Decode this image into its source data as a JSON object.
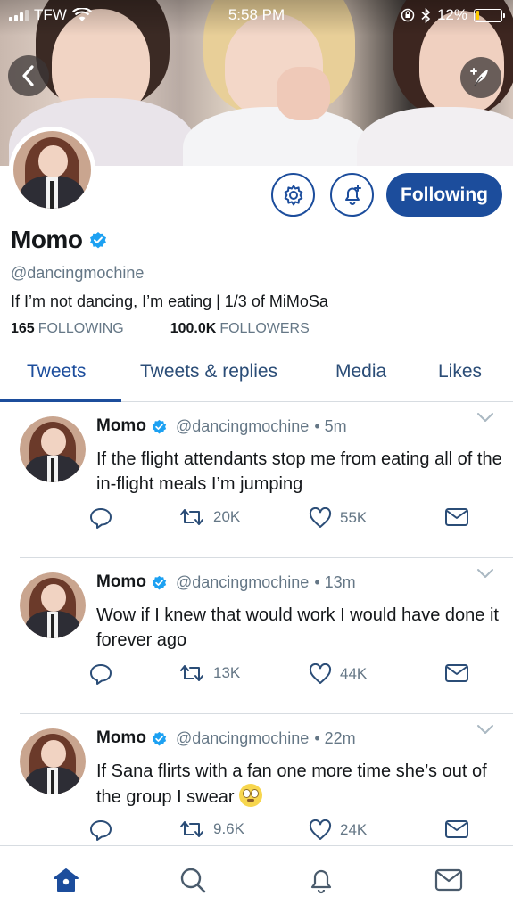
{
  "status_bar": {
    "carrier": "TFW",
    "time": "5:58 PM",
    "battery": "12%",
    "battery_level": 0.12,
    "icons": [
      "signal-icon",
      "wifi-icon",
      "orientation-lock-icon",
      "bluetooth-icon",
      "battery-icon"
    ]
  },
  "profile": {
    "name": "Momo",
    "verified": true,
    "handle": "@dancingmochine",
    "bio": "If I’m not dancing, I’m eating | 1/3 of MiMoSa",
    "following_count": "165",
    "following_label": "FOLLOWING",
    "followers_count": "100.0K",
    "followers_label": "FOLLOWERS",
    "follow_button": "Following"
  },
  "tabs": [
    {
      "label": "Tweets",
      "active": true
    },
    {
      "label": "Tweets & replies",
      "active": false
    },
    {
      "label": "Media",
      "active": false
    },
    {
      "label": "Likes",
      "active": false
    }
  ],
  "tweets": [
    {
      "name": "Momo",
      "handle": "@dancingmochine",
      "time": "• 5m",
      "text": "If the flight attendants stop me from eating all of the in-flight meals I’m jumping",
      "retweets": "20K",
      "likes": "55K"
    },
    {
      "name": "Momo",
      "handle": "@dancingmochine",
      "time": "• 13m",
      "text": "Wow if I knew that would work I would have done it forever ago",
      "retweets": "13K",
      "likes": "44K"
    },
    {
      "name": "Momo",
      "handle": "@dancingmochine",
      "time": "• 22m",
      "text": "If Sana flirts with a fan one more time she’s out of the group I swear",
      "emoji": "face-with-rolling-eyes",
      "retweets": "9.6K",
      "likes": "24K"
    }
  ],
  "bottom_nav": [
    "home-icon",
    "search-icon",
    "notifications-icon",
    "messages-icon"
  ],
  "colors": {
    "accent": "#1c4d9c",
    "verified": "#1da1f2",
    "secondary_text": "#657786",
    "divider": "#d7dce1"
  }
}
